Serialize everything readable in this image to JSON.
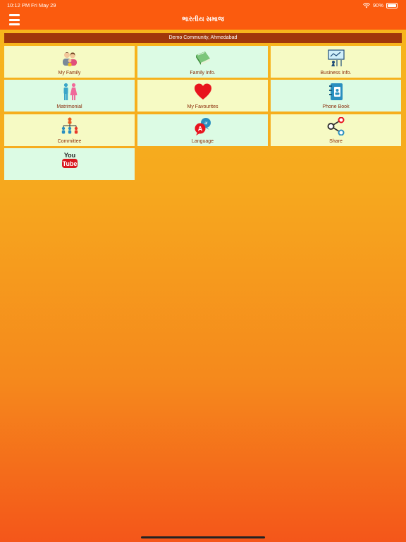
{
  "status": {
    "time": "10:12 PM",
    "date": "Fri May 29",
    "battery": "90%"
  },
  "header": {
    "title": "ભારતીય સમાજ"
  },
  "community": "Demo Community, Ahmedabad",
  "tiles": [
    {
      "label": "My Family",
      "icon": "family-icon"
    },
    {
      "label": "Family Info.",
      "icon": "book-icon"
    },
    {
      "label": "Business Info.",
      "icon": "presentation-icon"
    },
    {
      "label": "Matrimonial",
      "icon": "couple-icon"
    },
    {
      "label": "My Favourites",
      "icon": "heart-icon"
    },
    {
      "label": "Phone Book",
      "icon": "contact-book-icon"
    },
    {
      "label": "Committee",
      "icon": "org-chart-icon"
    },
    {
      "label": "Language",
      "icon": "language-icon"
    },
    {
      "label": "Share",
      "icon": "share-icon"
    },
    {
      "label": "",
      "icon": "youtube-icon",
      "icon_text_top": "You",
      "icon_text_bottom": "Tube"
    }
  ],
  "colors": {
    "accent": "#fb5b0e",
    "banner": "#a0370b",
    "tile_yellow": "#f6fac4",
    "tile_green": "#dcfbe4",
    "label": "#8a2b09"
  }
}
